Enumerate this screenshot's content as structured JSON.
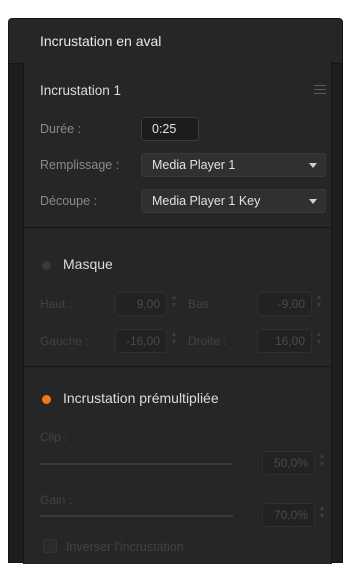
{
  "window": {
    "title": "Incrustation en aval"
  },
  "dsk": {
    "header": "Incrustation 1",
    "menu_icon": "hamburger-menu-icon"
  },
  "rate": {
    "label": "Durée :",
    "value": "0:25"
  },
  "fill": {
    "label": "Remplissage :",
    "value": "Media Player 1"
  },
  "key": {
    "label": "Découpe :",
    "value": "Media Player 1 Key"
  },
  "mask": {
    "label": "Masque",
    "enabled": false,
    "top_label": "Haut :",
    "top_value": "9,00",
    "bottom_label": "Bas :",
    "bottom_value": "-9,00",
    "left_label": "Gauche :",
    "left_value": "-16,00",
    "right_label": "Droite :",
    "right_value": "16,00"
  },
  "premult": {
    "label": "Incrustation prémultipliée",
    "enabled": true,
    "clip_label": "Clip :",
    "clip_value": "50,0%",
    "clip_level": 0.5,
    "gain_label": "Gain :",
    "gain_value": "70,0%",
    "gain_level": 0.7,
    "invert_label": "Inverser l'incrustation"
  },
  "colors": {
    "accent": "#f07a1a",
    "inactive_dot": "#3a3a3a"
  }
}
